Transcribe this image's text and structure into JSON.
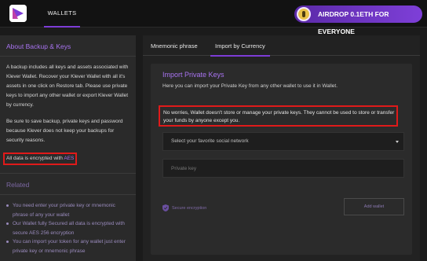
{
  "header": {
    "nav_wallets": "WALLETS",
    "airdrop_label": "AIRDROP 0.1ETH FOR EVERYONE",
    "accent": "#7d3cd6"
  },
  "sidebar": {
    "about_title": "About Backup & Keys",
    "about_p1": "A backup includes all keys and assets associated with Klever Wallet. Recover your Klever Wallet with all it's assets in one click on Restore tab. Please use private keys to import any other wallet or export Klever Wallet by currency.",
    "about_p2": "Be sure to save backup, private keys and password because Klever does not keep your backups for security reasons.",
    "encrypted_prefix": "All data is encrypted with ",
    "encrypted_aes": "AES",
    "related_title": "Related",
    "related_items": [
      "You need enter your private key or mnemonic phrase of any your wallet",
      "Our Wallet fully Secured all data is encrypted with secure AES 256 encryption",
      "You can import your token for any wallet just enter private key or mnemonic phrase"
    ]
  },
  "main": {
    "tabs": [
      {
        "label": "Mnemonic phrase"
      },
      {
        "label": "Import by Currency"
      }
    ],
    "card_title": "Import Private Keys",
    "card_desc": "Here you can import your Private Key from any other wallet to use it in Wallet.",
    "warning": "No worries, Wallet doesn't store or manage your private keys. They cannot be used to store or transfer your funds by anyone except you.",
    "select_placeholder": "Select your favorite social network",
    "private_key_placeholder": "Private key",
    "secure_label": "Secure encryption",
    "add_button": "Add wallet"
  },
  "icons": {
    "logo": "klever-logo-icon",
    "airdrop": "eth-coin-icon",
    "secure": "shield-icon",
    "select": "chevron-down-icon"
  }
}
